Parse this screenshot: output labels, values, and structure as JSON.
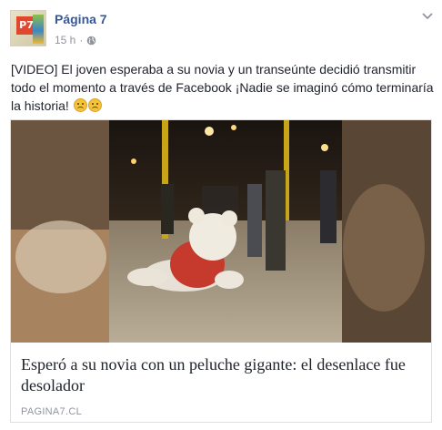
{
  "header": {
    "page_name": "Página 7",
    "timestamp": "15 h",
    "separator": "·",
    "avatar_text": "P7"
  },
  "post": {
    "text": "[VIDEO] El joven esperaba a su novia y un transeúnte decidió transmitir todo el momento a través de Facebook ¡Nadie se imaginó cómo terminaría la historia!"
  },
  "link_card": {
    "title": "Esperó a su novia con un peluche gigante: el desenlace fue desolador",
    "domain": "PAGINA7.CL"
  },
  "colors": {
    "link_blue": "#365899",
    "meta_gray": "#90949c",
    "text": "#1d2129",
    "border": "#dddfe2"
  },
  "icons": {
    "privacy": "globe-icon",
    "options": "chevron-down-icon",
    "reaction": "sad-face-emoji"
  }
}
